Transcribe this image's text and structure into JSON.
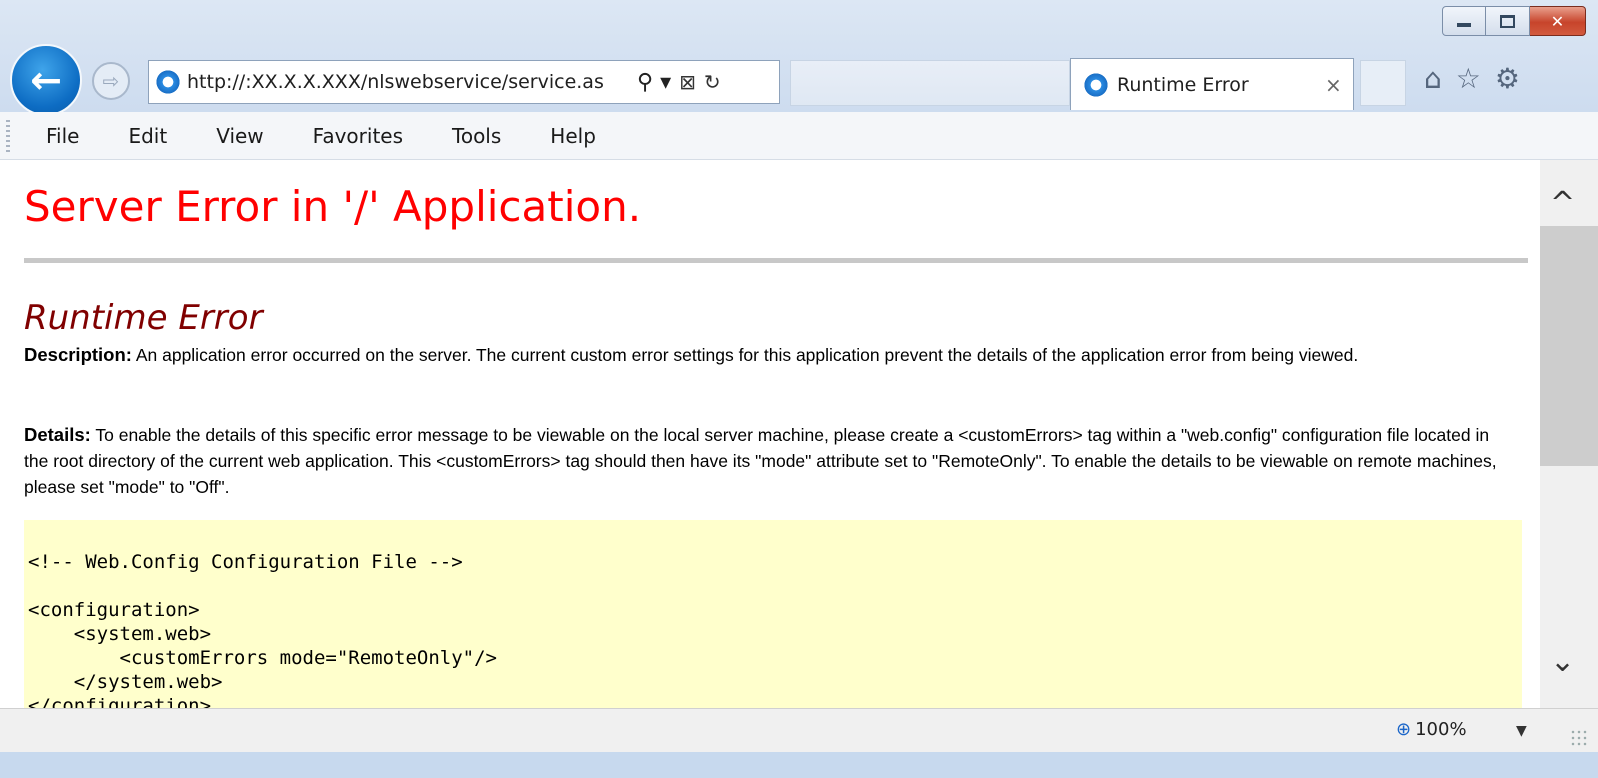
{
  "browser": {
    "address_url": "http://:XX.X.X.XXX/nlswebservice/service.as",
    "tab_title": "Runtime Error",
    "tab_close": "×",
    "back_glyph": "←",
    "forward_glyph": "⇨",
    "search_glyph": "⚲ ▾",
    "compat_glyph": "⊠",
    "refresh_glyph": "↻",
    "home_glyph": "⌂",
    "favorites_glyph": "☆",
    "settings_glyph": "⚙",
    "close_glyph": "✕"
  },
  "menu": [
    "File",
    "Edit",
    "View",
    "Favorites",
    "Tools",
    "Help"
  ],
  "page": {
    "title": "Server Error in '/' Application.",
    "subtitle": "Runtime Error",
    "description_label": "Description:",
    "description_text": " An application error occurred on the server. The current custom error settings for this application prevent the details of the application error from being viewed.",
    "details_label": "Details:",
    "details_text": " To enable the details of this specific error message to be viewable on the local server machine, please create a <customErrors> tag within a \"web.config\" configuration file located in the root directory of the current web application. This <customErrors> tag should then have its \"mode\" attribute set to \"RemoteOnly\". To enable the details to be viewable on remote machines, please set \"mode\" to \"Off\".",
    "code": "<!-- Web.Config Configuration File -->\n\n<configuration>\n    <system.web>\n        <customErrors mode=\"RemoteOnly\"/>\n    </system.web>\n</configuration>"
  },
  "status": {
    "zoom": "100%",
    "zoom_arrow": "▼"
  },
  "scroll": {
    "up": "^",
    "down": "⌄"
  }
}
